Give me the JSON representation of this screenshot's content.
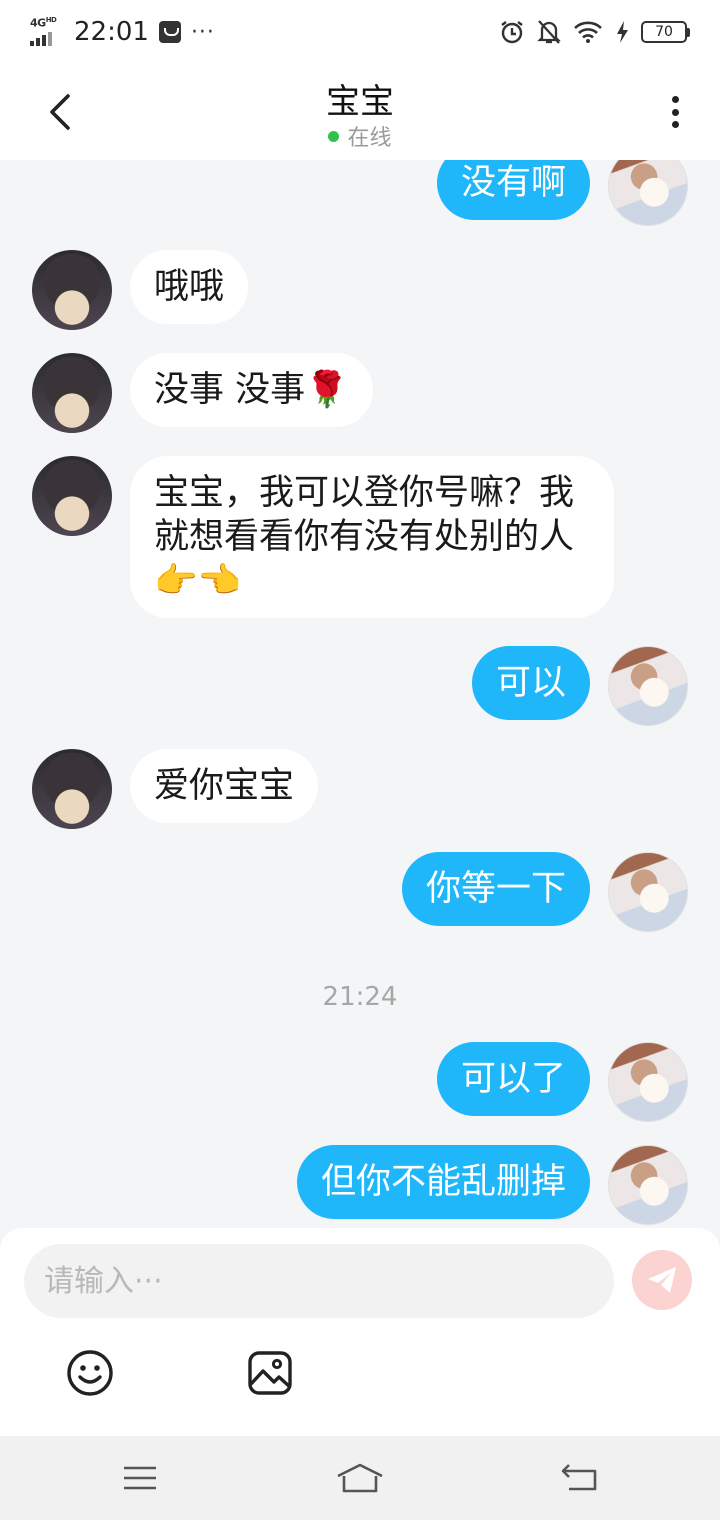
{
  "status_bar": {
    "network": "4G",
    "network_sup": "HD",
    "time": "22:01",
    "more": "···",
    "battery": "70"
  },
  "header": {
    "title": "宝宝",
    "status": "在线"
  },
  "messages": [
    {
      "side": "right",
      "text": "没有啊"
    },
    {
      "side": "left",
      "text": "哦哦"
    },
    {
      "side": "left",
      "text": "没事 没事🌹"
    },
    {
      "side": "left",
      "text": "宝宝，我可以登你号嘛？我就想看看你有没有处别的人👉👈"
    },
    {
      "side": "right",
      "text": "可以"
    },
    {
      "side": "left",
      "text": "爱你宝宝"
    },
    {
      "side": "right",
      "text": "你等一下"
    },
    {
      "side": "right",
      "text": "可以了"
    },
    {
      "side": "right",
      "text": "但你不能乱删掉"
    }
  ],
  "timestamp": "21:24",
  "composer": {
    "placeholder": "请输入···",
    "value": ""
  },
  "icons": {
    "emoji": "emoji-icon",
    "image": "image-icon",
    "send": "send-icon",
    "back": "chevron-left-icon",
    "more": "more-vertical-icon"
  },
  "colors": {
    "sent_bubble": "#1fb6fa",
    "received_bubble": "#ffffff",
    "online": "#31c24d",
    "send_button": "#fbd3d0"
  }
}
